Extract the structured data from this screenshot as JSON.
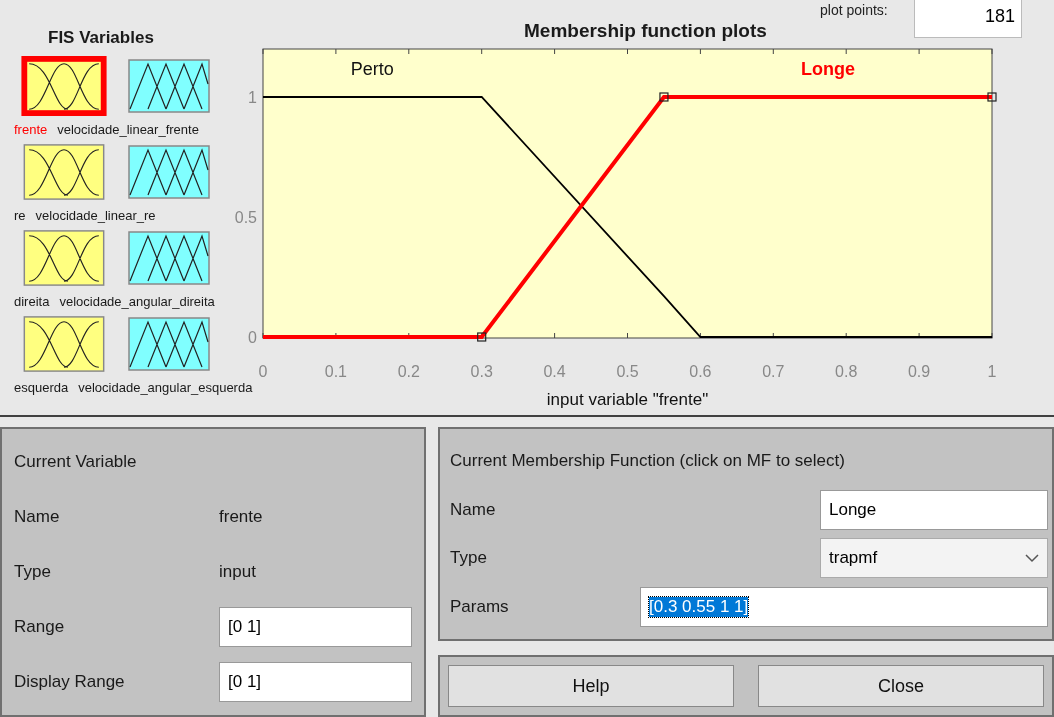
{
  "fis_variables": {
    "title": "FIS Variables",
    "rows": [
      {
        "input": {
          "name": "frente",
          "selected": true
        },
        "output": {
          "name": "velocidade_linear_frente",
          "selected": false
        }
      },
      {
        "input": {
          "name": "re",
          "selected": false
        },
        "output": {
          "name": "velocidade_linear_re",
          "selected": false
        }
      },
      {
        "input": {
          "name": "direita",
          "selected": false
        },
        "output": {
          "name": "velocidade_angular_direita",
          "selected": false
        }
      },
      {
        "input": {
          "name": "esquerda",
          "selected": false
        },
        "output": {
          "name": "velocidade_angular_esquerda",
          "selected": false
        }
      }
    ]
  },
  "plot": {
    "plot_points_label": "plot points:",
    "plot_points": "181",
    "membership_functions": [
      {
        "selected": false
      },
      {
        "selected": true
      }
    ],
    "chart_data": {
      "type": "line",
      "title": "Membership function plots",
      "xlabel": "input variable \"frente\"",
      "x": [
        0,
        0.3,
        0.55,
        0.6,
        1
      ],
      "series": [
        {
          "name": "Perto",
          "color": "#000000",
          "values": [
            1,
            1,
            0.17,
            0,
            0
          ]
        },
        {
          "name": "Longe",
          "color": "#ff0000",
          "values": [
            0,
            0,
            1,
            1,
            1
          ]
        }
      ],
      "xlim": [
        0,
        1
      ],
      "ylim": [
        0,
        1.2
      ],
      "xticks": [
        0,
        0.1,
        0.2,
        0.3,
        0.4,
        0.5,
        0.6,
        0.7,
        0.8,
        0.9,
        1
      ],
      "yticks": [
        0,
        0.5,
        1
      ]
    }
  },
  "current_variable": {
    "title": "Current Variable",
    "name_label": "Name",
    "name": "frente",
    "type_label": "Type",
    "type": "input",
    "range_label": "Range",
    "range": "[0 1]",
    "display_range_label": "Display Range",
    "display_range": "[0 1]"
  },
  "current_mf": {
    "title": "Current Membership Function (click on MF to select)",
    "name_label": "Name",
    "name": "Longe",
    "type_label": "Type",
    "type": "trapmf",
    "params_label": "Params",
    "params": "[0.3 0.55 1 1]",
    "params_highlighted": true
  },
  "buttons": [
    "Help",
    "Close"
  ]
}
